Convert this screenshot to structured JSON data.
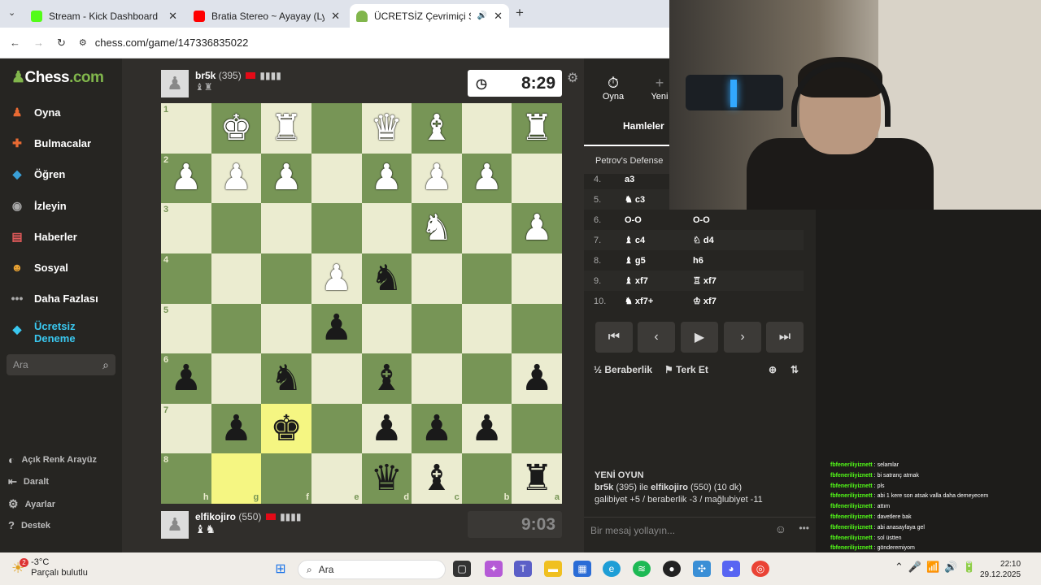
{
  "browser": {
    "tabs": [
      {
        "title": "Stream - Kick Dashboard",
        "color": "#53fc18"
      },
      {
        "title": "Bratia Stereo ~ Ayayay (Lyrics) f",
        "color": "#ff0000"
      },
      {
        "title": "ÜCRETSİZ Çevrimiçi Satranç",
        "color": "#81b64c"
      }
    ],
    "url": "chess.com/game/147336835022"
  },
  "sidebar": {
    "logo_main": "Chess",
    "logo_suffix": ".com",
    "items": [
      {
        "label": "Oyna",
        "icon": "pawn-icon",
        "color": "#e86a33"
      },
      {
        "label": "Bulmacalar",
        "icon": "puzzle-icon",
        "color": "#e86a33"
      },
      {
        "label": "Öğren",
        "icon": "cube-icon",
        "color": "#3aa0d8"
      },
      {
        "label": "İzleyin",
        "icon": "binoculars-icon",
        "color": "#888"
      },
      {
        "label": "Haberler",
        "icon": "newspaper-icon",
        "color": "#c33"
      },
      {
        "label": "Sosyal",
        "icon": "people-icon",
        "color": "#e8a233"
      },
      {
        "label": "Daha Fazlası",
        "icon": "dots-icon",
        "color": "#888"
      },
      {
        "label": "Ücretsiz Deneme",
        "icon": "diamond-icon",
        "color": "#3ac8f0"
      }
    ],
    "search_placeholder": "Ara",
    "bottom": [
      "Açık Renk Arayüz",
      "Daralt",
      "Ayarlar",
      "Destek"
    ]
  },
  "top_player": {
    "name": "br5k",
    "rating": "(395)",
    "clock": "8:29"
  },
  "bottom_player": {
    "name": "elfikojiro",
    "rating": "(550)",
    "clock": "9:03"
  },
  "board": {
    "ranks": [
      "1",
      "2",
      "3",
      "4",
      "5",
      "6",
      "7",
      "8"
    ],
    "files": [
      "h",
      "g",
      "f",
      "e",
      "d",
      "c",
      "b",
      "a"
    ],
    "rows": [
      [
        "",
        "wK",
        "wR",
        "",
        "wQ",
        "wB",
        "",
        "wR"
      ],
      [
        "wP",
        "wP",
        "wP",
        "",
        "wP",
        "wP",
        "wP",
        ""
      ],
      [
        "",
        "",
        "",
        "",
        "",
        "wN",
        "",
        "wP"
      ],
      [
        "",
        "",
        "",
        "wP",
        "bN",
        "",
        "",
        ""
      ],
      [
        "",
        "",
        "",
        "bP",
        "",
        "",
        "",
        ""
      ],
      [
        "bP",
        "",
        "bN",
        "",
        "bB",
        "",
        "",
        "bP"
      ],
      [
        "",
        "bP",
        "bK",
        "",
        "bP",
        "bP",
        "bP",
        ""
      ],
      [
        "",
        "",
        "",
        "",
        "bQ",
        "bB",
        "",
        "bR"
      ]
    ],
    "highlights": [
      [
        6,
        2
      ],
      [
        7,
        1
      ]
    ]
  },
  "panel": {
    "tab_play": "Oyna",
    "tab_new": "Yeni",
    "moves_tab": "Hamleler",
    "opening": "Petrov's Defense",
    "moves": [
      {
        "n": "4.",
        "w": "a3",
        "b": ""
      },
      {
        "n": "5.",
        "w": "♞ c3",
        "b": ""
      },
      {
        "n": "6.",
        "w": "O-O",
        "b": "O-O"
      },
      {
        "n": "7.",
        "w": "♝ c4",
        "b": "♘ d4"
      },
      {
        "n": "8.",
        "w": "♝ g5",
        "b": "h6"
      },
      {
        "n": "9.",
        "w": "♝ xf7",
        "b": "♖ xf7"
      },
      {
        "n": "10.",
        "w": "♞ xf7+",
        "b": "♔ xf7"
      }
    ],
    "draw": "Beraberlik",
    "resign": "Terk Et",
    "new_game_title": "YENİ OYUN",
    "new_game_p1": "br5k",
    "new_game_p1_rating": "(395)",
    "new_game_with": "ile",
    "new_game_p2": "elfikojiro",
    "new_game_p2_rating": "(550) (10 dk)",
    "record": "galibiyet +5 / beraberlik -3 / mağlubiyet -11",
    "message_placeholder": "Bir mesaj yollayın..."
  },
  "chat": [
    {
      "user": "fbfeneriliyiznett",
      "text": "selamlar"
    },
    {
      "user": "fbfeneriliyiznett",
      "text": "bi satranç atmak"
    },
    {
      "user": "fbfeneriliyiznett",
      "text": "pls"
    },
    {
      "user": "fbfeneriliyiznett",
      "text": "abi 1 kere son atsak valla daha demeyecem"
    },
    {
      "user": "fbfeneriliyiznett",
      "text": "attım"
    },
    {
      "user": "fbfeneriliyiznett",
      "text": "davetlere bak"
    },
    {
      "user": "fbfeneriliyiznett",
      "text": "abi anasayfaya gel"
    },
    {
      "user": "fbfeneriliyiznett",
      "text": "sol üstten"
    },
    {
      "user": "fbfeneriliyiznett",
      "text": "gönderemiyom"
    }
  ],
  "taskbar": {
    "temp": "-3°C",
    "weather": "Parçalı bulutlu",
    "weather_badge": "2",
    "search": "Ara",
    "time": "22:10",
    "date": "29.12.2025"
  }
}
